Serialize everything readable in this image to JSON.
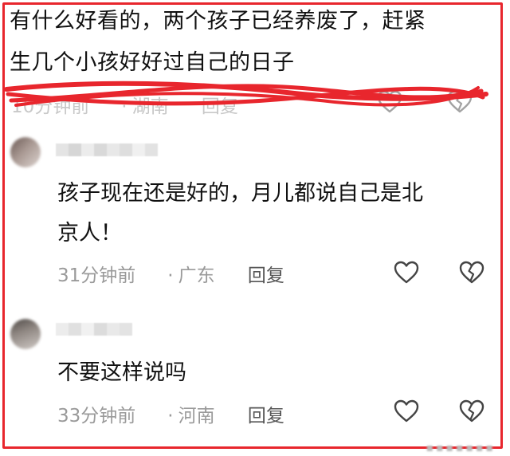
{
  "post": {
    "text_line1": "有什么好看的，两个孩子已经养废了，赶紧",
    "text_line2": "生几个小孩好好过自己的日子",
    "time": "10分钟前",
    "location": "湖南",
    "reply_label": "回复"
  },
  "comments": [
    {
      "text_line1": "孩子现在还是好的，月儿都说自己是北",
      "text_line2": "京人！",
      "time": "31分钟前",
      "location": "广东",
      "reply_label": "回复"
    },
    {
      "text_line1": "不要这样说吗",
      "time": "33分钟前",
      "location": "河南",
      "reply_label": "回复"
    }
  ],
  "separator": "·",
  "icons": {
    "like": "heart-outline-icon",
    "dislike": "broken-heart-outline-icon"
  },
  "colors": {
    "frame": "#e8262d",
    "scribble": "#e8262d",
    "meta_text": "#9a9a9a"
  }
}
